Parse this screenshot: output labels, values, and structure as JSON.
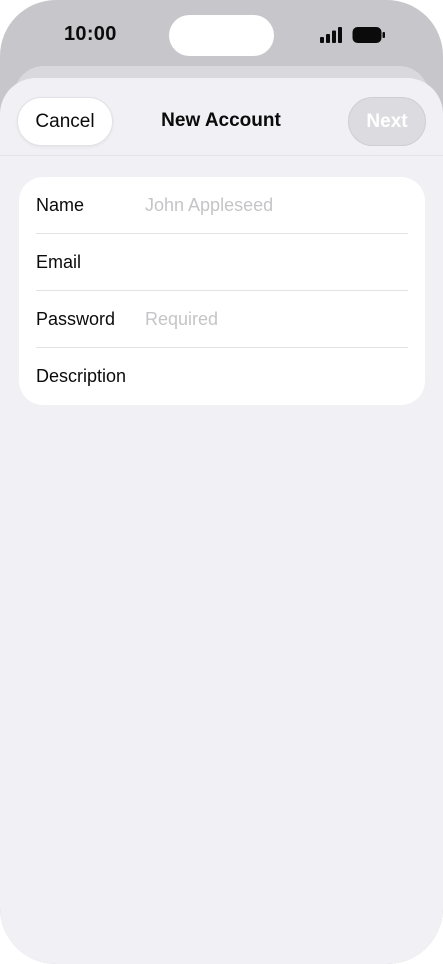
{
  "status_bar": {
    "time": "10:00",
    "signal_icon": "cellular-signal-icon",
    "battery_icon": "battery-icon"
  },
  "nav": {
    "cancel_label": "Cancel",
    "title": "New Account",
    "next_label": "Next"
  },
  "form": {
    "rows": [
      {
        "label": "Name",
        "value": "",
        "placeholder": "John Appleseed"
      },
      {
        "label": "Email",
        "value": "",
        "placeholder": ""
      },
      {
        "label": "Password",
        "value": "",
        "placeholder": "Required"
      },
      {
        "label": "Description",
        "value": "",
        "placeholder": ""
      }
    ]
  },
  "colors": {
    "sheet_background": "#f1f0f5",
    "card_background": "#ffffff",
    "placeholder_text": "#c5c5c8",
    "disabled_button": "#dcdbe0"
  }
}
